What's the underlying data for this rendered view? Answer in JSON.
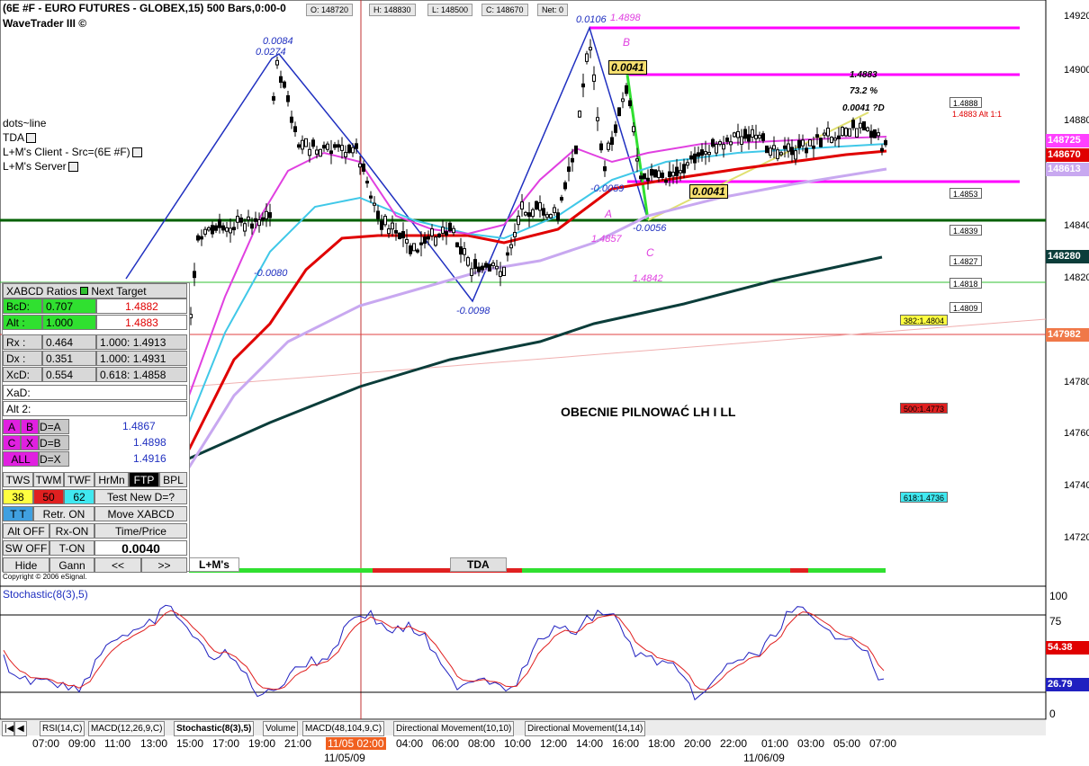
{
  "header": {
    "title": "(6E #F - EURO FUTURES - GLOBEX,15) 500 Bars,0:00-0",
    "subtitle": "WaveTrader III ©",
    "ohlc": [
      "O: 148720",
      "H: 148830",
      "L: 148500",
      "C: 148670",
      "Net: 0"
    ]
  },
  "studies": {
    "dots": "dots~line",
    "tda": "TDA",
    "client": "L+M's Client - Src=(6E #F)",
    "server": "L+M's Server"
  },
  "panel": {
    "title": "XABCD Ratios",
    "next_target": "Next Target",
    "bcd_label": "BcD:",
    "bcd_val": "0.707",
    "bcd_target": "1.4882",
    "alt_label": "Alt :",
    "alt_val": "1.000",
    "alt_target": "1.4883",
    "rx_label": "Rx :",
    "rx_val": "0.464",
    "rx_target": "1.000: 1.4913",
    "dx_label": "Dx :",
    "dx_val": "0.351",
    "dx_target": "1.000: 1.4931",
    "xcd_label": "XcD:",
    "xcd_val": "0.554",
    "xcd_target": "0.618: 1.4858",
    "xad_label": "XaD:",
    "alt2_label": "Alt 2:",
    "ab": [
      "A",
      "B"
    ],
    "cx": [
      "C",
      "X"
    ],
    "all": "ALL",
    "d_eq_a": "D=A",
    "d_eq_b": "D=B",
    "d_eq_x": "D=X",
    "d_a_val": "1.4867",
    "d_b_val": "1.4898",
    "d_x_val": "1.4916",
    "row_tws": [
      "TWS",
      "TWM",
      "TWF",
      "HrMn",
      "FTP",
      "BPL"
    ],
    "n1": "38",
    "n2": "50",
    "n3": "62",
    "test_new": "Test New D=?",
    "tt": "T T",
    "retr": "Retr. ON",
    "move": "Move XABCD",
    "alt_off": "Alt OFF",
    "rx_on": "Rx-ON",
    "time_price": "Time/Price",
    "sw_off": "SW OFF",
    "t_on": "T-ON",
    "value": "0.0040",
    "hide": "Hide",
    "gann": "Gann",
    "prev": "<<",
    "next": ">>",
    "copyright": "Copyright © 2006 eSignal."
  },
  "annotations": {
    "a1": "0.0084",
    "a2": "0.0274",
    "a3": "-0.0080",
    "a4": "-0.0098",
    "a5": "0.0106",
    "a6": "1.4898",
    "a7": "B",
    "a8": "0.0041",
    "a9": "-0.0059",
    "a10": "A",
    "a11": "-0.0056",
    "a12": "1.4857",
    "a13": "C",
    "a14": "1.4842",
    "a15": "0.0041",
    "a16": "1.4883",
    "a17": "73.2 %",
    "a18": "0.0041 ?D",
    "a19": "1.4883 Alt 1:1",
    "comment": "OBECNIE PILNOWAĆ LH I LL",
    "lm": "L+M's",
    "tda_box": "TDA"
  },
  "price_tags": {
    "t1": "1.4888",
    "t2": "1.4853",
    "t3": "1.4839",
    "t4": "1.4827",
    "t5": "1.4818",
    "t6": "1.4809",
    "t7": "382:1.4804",
    "t8": "500:1.4773",
    "t9": "618:1.4736"
  },
  "price_axis": {
    "labels": [
      "149200",
      "149000",
      "148800",
      "148400",
      "148200",
      "147800",
      "147600",
      "147400",
      "147200"
    ],
    "boxes": {
      "b1": "148725",
      "b2": "148670",
      "b3": "148613",
      "b4": "148280",
      "b5": "147982"
    }
  },
  "stoch": {
    "title": "Stochastic(8(3),5)",
    "axis": [
      "100",
      "75",
      "0"
    ],
    "v1": "54.38",
    "v2": "26.79"
  },
  "tabs": [
    "RSI(14,C)",
    "MACD(12,26,9,C)",
    "Stochastic(8(3),5)",
    "Volume",
    "MACD(48,104,9,C)",
    "Directional Movement(10,10)",
    "Directional Movement(14,14)"
  ],
  "time_axis": {
    "labels": [
      "07:00",
      "09:00",
      "11:00",
      "13:00",
      "15:00",
      "17:00",
      "19:00",
      "21:00",
      "11/05 02:00",
      "04:00",
      "06:00",
      "08:00",
      "10:00",
      "12:00",
      "14:00",
      "16:00",
      "18:00",
      "20:00",
      "22:00",
      "01:00",
      "03:00",
      "05:00",
      "07:00"
    ],
    "date1": "11/05/09",
    "date2": "11/06/09"
  },
  "colors": {
    "magenta": "#ff00ff",
    "red": "#ee0000",
    "green": "#007000",
    "navy": "#0b3d3a",
    "cyan": "#40c8e8",
    "lavender": "#c8a8f0"
  }
}
